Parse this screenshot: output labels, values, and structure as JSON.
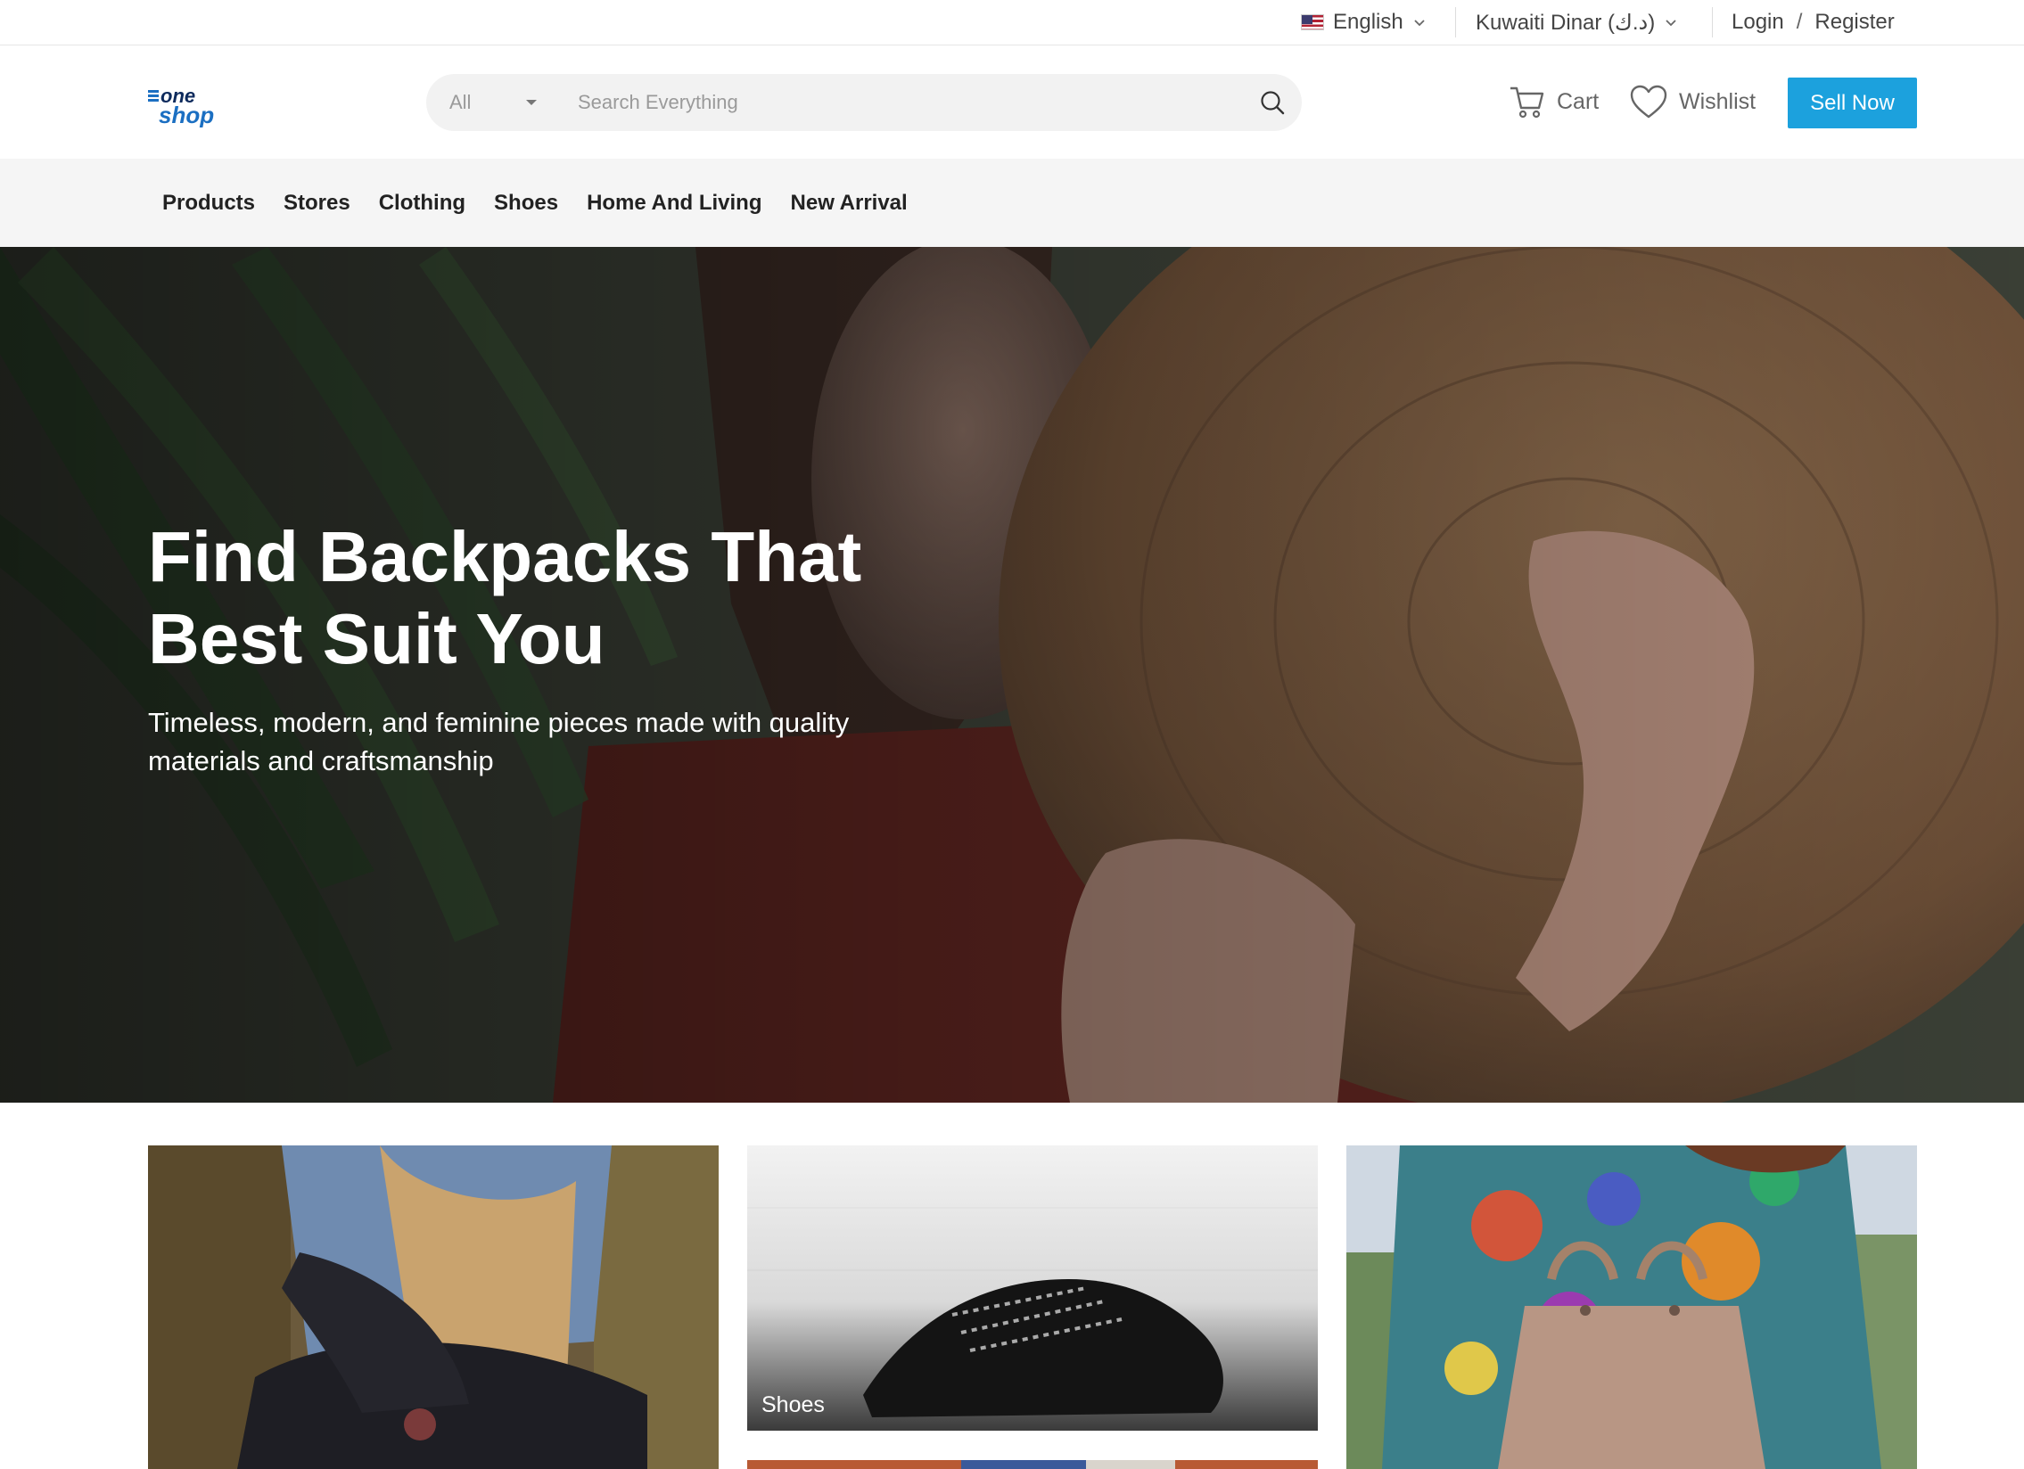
{
  "topbar": {
    "language": "English",
    "currency": "Kuwaiti Dinar (د.ك)",
    "login": "Login",
    "separator": "/",
    "register": "Register"
  },
  "header": {
    "logo_top": "one",
    "logo_bottom": "shop",
    "search_category": "All",
    "search_placeholder": "Search Everything",
    "cart_label": "Cart",
    "wishlist_label": "Wishlist",
    "sell_label": "Sell Now"
  },
  "nav": {
    "items": [
      "Products",
      "Stores",
      "Clothing",
      "Shoes",
      "Home And Living",
      "New Arrival"
    ]
  },
  "hero": {
    "title": "Find Backpacks That Best Suit You",
    "subtitle": "Timeless, modern, and feminine pieces made with quality materials and craftsmanship"
  },
  "tiles": {
    "shoes_label": "Shoes"
  },
  "colors": {
    "accent": "#1ca1dd",
    "logo_blue": "#1b6fc2"
  },
  "icons": [
    "us-flag-icon",
    "chevron-down-icon",
    "search-icon",
    "cart-icon",
    "heart-icon",
    "caret-down-icon"
  ]
}
